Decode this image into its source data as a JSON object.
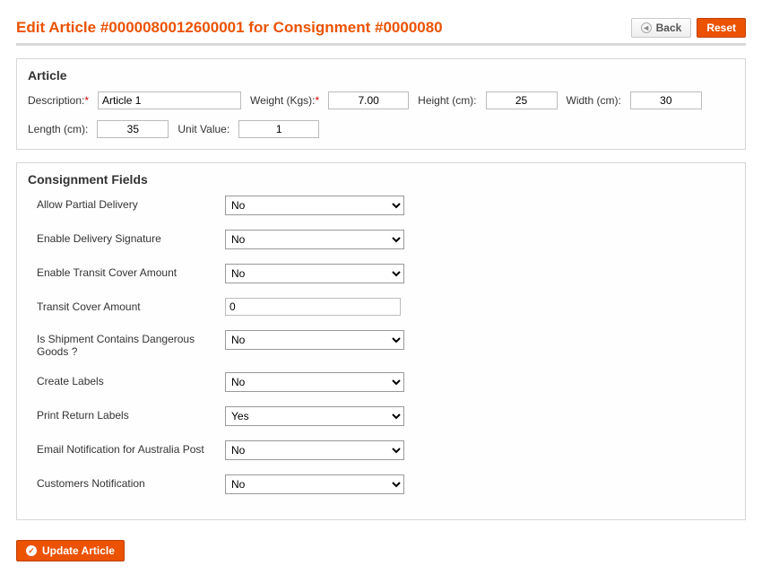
{
  "header": {
    "title": "Edit Article #0000080012600001 for Consignment #0000080",
    "back_label": "Back",
    "reset_label": "Reset"
  },
  "article": {
    "section_title": "Article",
    "description_label": "Description:",
    "description_value": "Article 1",
    "weight_label": "Weight (Kgs):",
    "weight_value": "7.00",
    "height_label": "Height (cm):",
    "height_value": "25",
    "width_label": "Width (cm):",
    "width_value": "30",
    "length_label": "Length (cm):",
    "length_value": "35",
    "unit_value_label": "Unit Value:",
    "unit_value_value": "1"
  },
  "consignment": {
    "section_title": "Consignment Fields",
    "options_yes": "Yes",
    "options_no": "No",
    "allow_partial_delivery_label": "Allow Partial Delivery",
    "allow_partial_delivery_value": "No",
    "enable_delivery_signature_label": "Enable Delivery Signature",
    "enable_delivery_signature_value": "No",
    "enable_transit_cover_label": "Enable Transit Cover Amount",
    "enable_transit_cover_value": "No",
    "transit_cover_amount_label": "Transit Cover Amount",
    "transit_cover_amount_value": "0",
    "dangerous_goods_label": "Is Shipment Contains Dangerous Goods ?",
    "dangerous_goods_value": "No",
    "create_labels_label": "Create Labels",
    "create_labels_value": "No",
    "print_return_labels_label": "Print Return Labels",
    "print_return_labels_value": "Yes",
    "email_notification_label": "Email Notification for Australia Post",
    "email_notification_value": "No",
    "customers_notification_label": "Customers Notification",
    "customers_notification_value": "No"
  },
  "footer": {
    "update_label": "Update Article"
  }
}
